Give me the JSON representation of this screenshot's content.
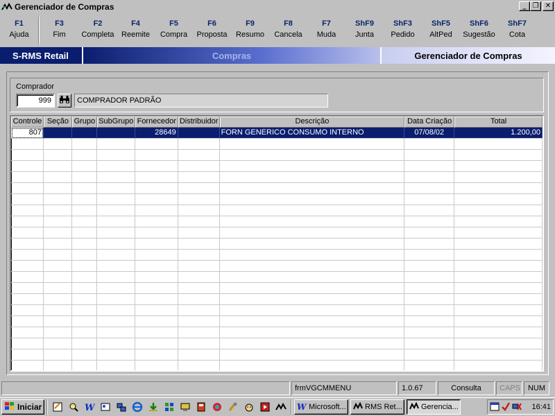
{
  "window": {
    "title": "Gerenciador de Compras",
    "btn_minimize": "_",
    "btn_maximize": "❐",
    "btn_close": "✕"
  },
  "fkeys": [
    {
      "key": "F1",
      "label": "Ajuda"
    },
    {
      "key": "F3",
      "label": "Fim"
    },
    {
      "key": "F2",
      "label": "Completa"
    },
    {
      "key": "F4",
      "label": "Reemite"
    },
    {
      "key": "F5",
      "label": "Compra"
    },
    {
      "key": "F6",
      "label": "Proposta"
    },
    {
      "key": "F9",
      "label": "Resumo"
    },
    {
      "key": "F8",
      "label": "Cancela"
    },
    {
      "key": "F7",
      "label": "Muda"
    },
    {
      "key": "ShF9",
      "label": "Junta"
    },
    {
      "key": "ShF3",
      "label": "Pedido"
    },
    {
      "key": "ShF5",
      "label": "AltPed"
    },
    {
      "key": "ShF6",
      "label": "Sugestão"
    },
    {
      "key": "ShF7",
      "label": "Cota"
    }
  ],
  "banner": {
    "product": "S-RMS Retail",
    "module": "Compras",
    "screen": "Gerenciador de Compras"
  },
  "comprador": {
    "label": "Comprador",
    "code": "999",
    "name": "COMPRADOR PADRÃO"
  },
  "grid": {
    "columns": [
      "Controle",
      "Seção",
      "Grupo",
      "SubGrupo",
      "Fornecedor",
      "Distribuidor",
      "Descrição",
      "Data Criação",
      "Total"
    ],
    "rows": [
      {
        "controle": "807",
        "secao": "",
        "grupo": "",
        "subgrupo": "",
        "fornecedor": "28649",
        "distribuidor": "",
        "descricao": "FORN GENERICO CONSUMO INTERNO",
        "data_criacao": "07/08/02",
        "total": "1.200,00"
      }
    ]
  },
  "statusbar": {
    "form": "frmVGCMMENU",
    "version": "1.0.67",
    "mode": "Consulta",
    "caps": "CAPS",
    "num": "NUM"
  },
  "taskbar": {
    "start_label": "Iniciar",
    "tasks": [
      "Microsoft...",
      "RMS Ret...",
      "Gerencia..."
    ],
    "clock": "16:41"
  },
  "colors": {
    "selection": "#0a1d6e",
    "fkey": "#0a246a"
  }
}
